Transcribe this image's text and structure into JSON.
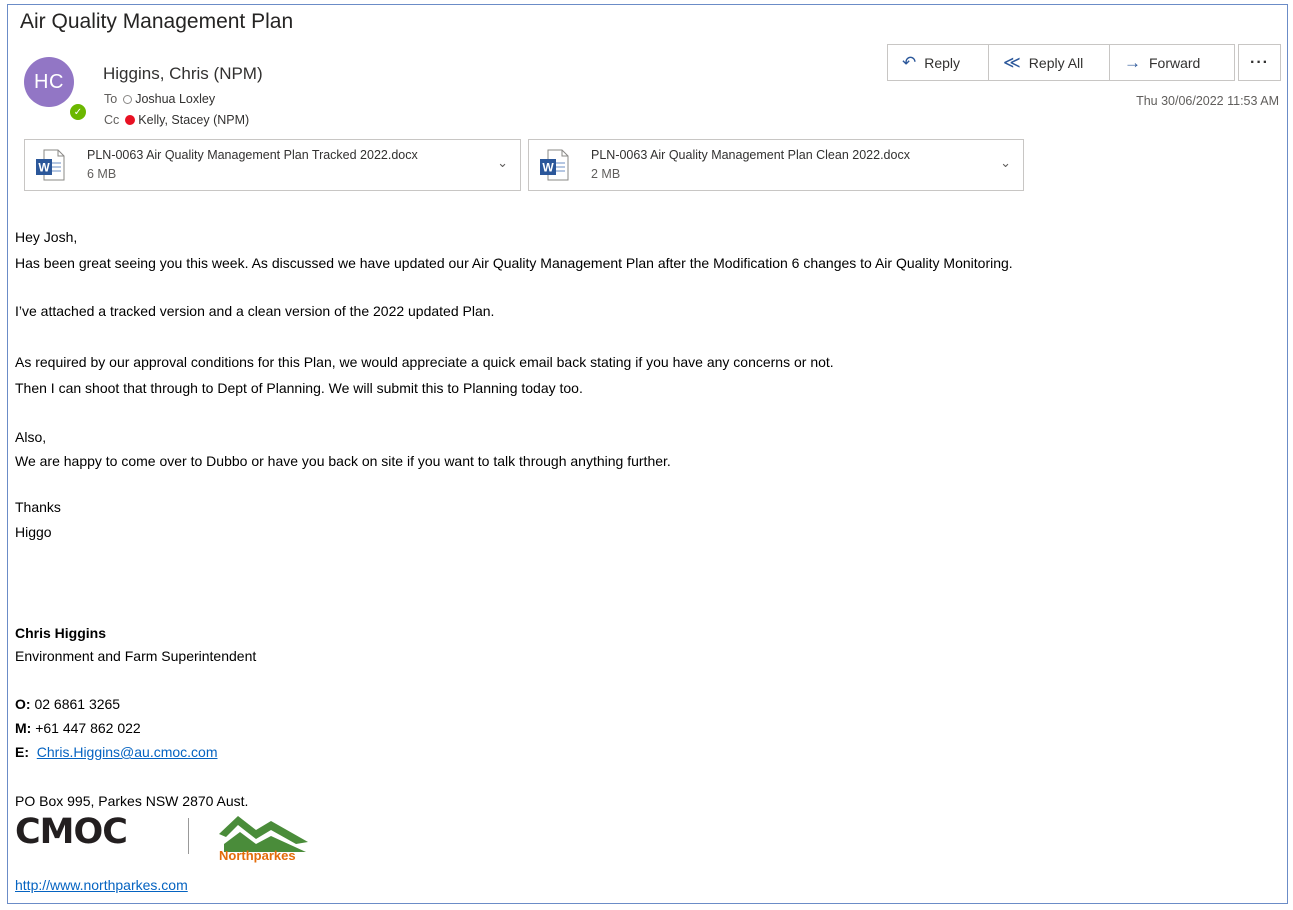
{
  "email": {
    "subject": "Air Quality Management Plan",
    "sender_initials": "HC",
    "sender_name": "Higgins, Chris (NPM)",
    "to_label": "To",
    "to_name": "Joshua Loxley",
    "cc_label": "Cc",
    "cc_name": "Kelly, Stacey (NPM)",
    "date": "Thu 30/06/2022 11:53 AM"
  },
  "actions": {
    "reply": "Reply",
    "reply_all": "Reply All",
    "forward": "Forward",
    "more": "···"
  },
  "attachments": [
    {
      "name": "PLN-0063 Air Quality Management Plan Tracked 2022.docx",
      "size": "6 MB",
      "icon": "word-doc-icon"
    },
    {
      "name": "PLN-0063 Air Quality Management Plan Clean 2022.docx",
      "size": "2 MB",
      "icon": "word-doc-icon"
    }
  ],
  "body": {
    "greeting": "Hey Josh,",
    "p1": "Has been great seeing you this week.  As discussed we have updated our Air Quality Management Plan after the Modification 6 changes to Air Quality Monitoring.",
    "p2": "I’ve attached a tracked version and a clean version of the 2022 updated Plan.",
    "p3a": "As required by our approval conditions for this Plan, we would appreciate a quick email back stating if you have any concerns or not.",
    "p3b": "Then I can shoot that through to Dept of Planning.  We will submit this to Planning today too.",
    "also": "Also,",
    "p4": "We are happy to come over to Dubbo or have you back on site if you want to talk through anything further.",
    "thanks": "Thanks",
    "signoff": "Higgo"
  },
  "signature": {
    "name": "Chris Higgins",
    "title": "Environment and Farm Superintendent",
    "office_label": "O:",
    "office": "02 6861 3265",
    "mobile_label": "M:",
    "mobile": "+61 447 862 022",
    "email_label": "E:",
    "email": "Chris.Higgins@au.cmoc.com",
    "address": "PO Box 995, Parkes NSW 2870 Aust.",
    "logo1": "CMOC",
    "logo2": "Northparkes",
    "website": "http://www.northparkes.com"
  },
  "colors": {
    "avatar": "#9276c5",
    "presence_available": "#6bb700",
    "presence_busy": "#e81123",
    "link": "#0563c1",
    "action_icon": "#2b579a",
    "northparkes_orange": "#e36c0a",
    "northparkes_green": "#4a8c3a"
  }
}
